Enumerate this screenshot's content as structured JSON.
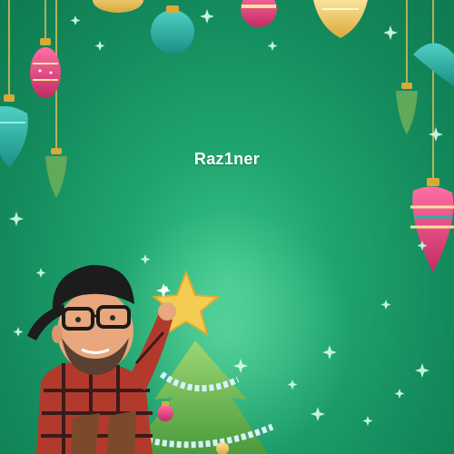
{
  "profile": {
    "username": "Raz1ner"
  },
  "theme": {
    "background": "#1fa36e",
    "accent_gold": "#f2c94c",
    "ornament_pink": "#e0457b",
    "ornament_teal": "#2ab3a6"
  },
  "icons": [
    "sparkle-icon",
    "ornament-icon",
    "star-icon",
    "christmas-tree-icon",
    "avatar-bitmoji"
  ]
}
